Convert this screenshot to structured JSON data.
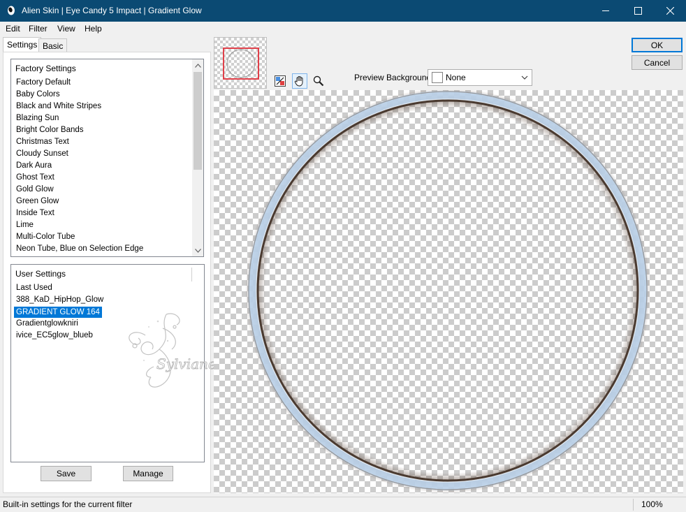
{
  "window": {
    "title": "Alien Skin | Eye Candy 5 Impact | Gradient Glow",
    "titlebar_color": "#0b4a73"
  },
  "menu": [
    "Edit",
    "Filter",
    "View",
    "Help"
  ],
  "tabs": {
    "settings": "Settings",
    "basic": "Basic"
  },
  "factory": {
    "header": "Factory Settings",
    "items": [
      "Factory Default",
      "Baby Colors",
      "Black and White Stripes",
      "Blazing Sun",
      "Bright Color Bands",
      "Christmas Text",
      "Cloudy Sunset",
      "Dark Aura",
      "Ghost Text",
      "Gold Glow",
      "Green Glow",
      "Inside Text",
      "Lime",
      "Multi-Color Tube",
      "Neon Tube, Blue on Selection Edge"
    ]
  },
  "user": {
    "header": "User Settings",
    "items": [
      "Last Used",
      "388_KaD_HipHop_Glow",
      "GRADIENT GLOW 164",
      "Gradientglowkniri",
      "ivice_EC5glow_blueb"
    ],
    "selected_index": 2,
    "selected_color": "#0078d7"
  },
  "buttons": {
    "save": "Save",
    "manage": "Manage",
    "ok": "OK",
    "cancel": "Cancel"
  },
  "preview": {
    "background_label": "Preview Background:",
    "background_value": "None",
    "tools": [
      "preview-toggle-icon",
      "hand-icon",
      "zoom-icon"
    ],
    "active_tool": "hand-icon"
  },
  "status": {
    "text": "Built-in settings for the current filter",
    "zoom": "100%"
  }
}
